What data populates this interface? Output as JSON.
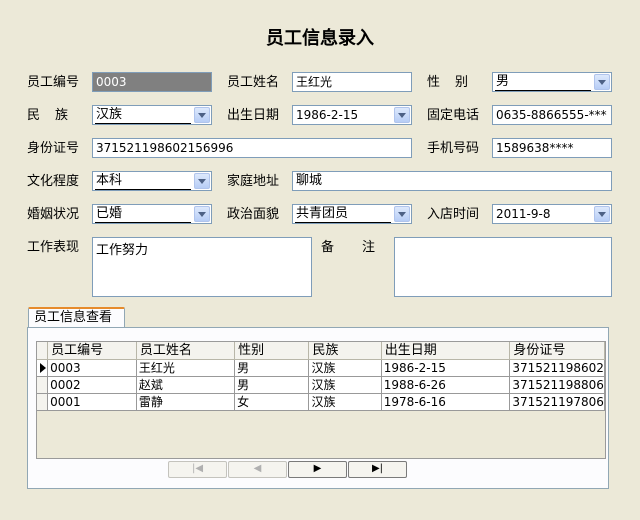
{
  "title": "员工信息录入",
  "labels": {
    "emp_no": "员工编号",
    "emp_name": "员工姓名",
    "gender": "性别",
    "ethnicity": "民族",
    "birth_date": "出生日期",
    "landline": "固定电话",
    "id_no": "身份证号",
    "mobile": "手机号码",
    "education": "文化程度",
    "address": "家庭地址",
    "marital": "婚姻状况",
    "political": "政治面貌",
    "hire_date": "入店时间",
    "performance": "工作表现",
    "remark": "备注"
  },
  "values": {
    "emp_no": "0003",
    "emp_name": "王红光",
    "gender": "男",
    "ethnicity": "汉族",
    "birth_date": "1986-2-15",
    "landline": "0635-8866555-***",
    "id_no": "371521198602156996",
    "mobile": "1589638****",
    "education": "本科",
    "address": "聊城",
    "marital": "已婚",
    "political": "共青团员",
    "hire_date": "2011-9-8",
    "performance": "工作努力",
    "remark": ""
  },
  "tab_label": "员工信息查看",
  "grid": {
    "columns": [
      "员工编号",
      "员工姓名",
      "性别",
      "民族",
      "出生日期",
      "身份证号"
    ],
    "rows": [
      [
        "0003",
        "王红光",
        "男",
        "汉族",
        "1986-2-15",
        "371521198602"
      ],
      [
        "0002",
        "赵斌",
        "男",
        "汉族",
        "1988-6-26",
        "371521198806"
      ],
      [
        "0001",
        "雷静",
        "女",
        "汉族",
        "1978-6-16",
        "371521197806"
      ]
    ]
  },
  "nav": {
    "first": "|◀",
    "prev": "◀",
    "next": "▶",
    "last": "▶|"
  },
  "colors": {
    "tab_accent": "#e68b2c",
    "readonly_field": "#808080"
  }
}
